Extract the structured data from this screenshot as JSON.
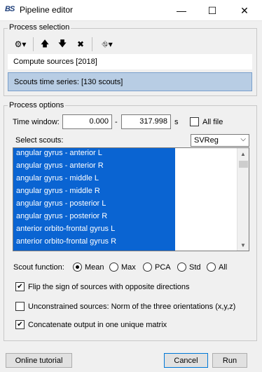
{
  "window": {
    "title": "Pipeline editor",
    "app_icon": "BS",
    "minimize_glyph": "—",
    "maximize_glyph": "☐",
    "close_glyph": "✕"
  },
  "process_selection": {
    "legend": "Process selection",
    "toolbar_glyphs": {
      "settings": "⚙▾",
      "up": "🡅",
      "down": "🡇",
      "delete": "✖",
      "pipeline": "⛗▾"
    },
    "items": [
      "Compute sources [2018]",
      "Scouts time series: [130 scouts]"
    ]
  },
  "process_options": {
    "legend": "Process options",
    "time_window_label": "Time window:",
    "time_start": "0.000",
    "time_sep": "-",
    "time_end": "317.998",
    "time_unit": "s",
    "all_file_label": "All file",
    "select_scouts_label": "Select scouts:",
    "atlas": "SVReg",
    "scouts": [
      "angular gyrus - anterior L",
      "angular gyrus - anterior R",
      "angular gyrus - middle L",
      "angular gyrus - middle R",
      "angular gyrus - posterior L",
      "angular gyrus - posterior R",
      "anterior orbito-frontal gyrus L",
      "anterior orbito-frontal gyrus R"
    ],
    "scout_function_label": "Scout function:",
    "scout_function_options": [
      "Mean",
      "Max",
      "PCA",
      "Std",
      "All"
    ],
    "scout_function_selected": "Mean",
    "flip_label": "Flip the sign of sources with opposite directions",
    "flip_checked": true,
    "unconstrained_label": "Unconstrained sources: Norm of the three orientations (x,y,z)",
    "unconstrained_checked": false,
    "concatenate_label": "Concatenate output in one unique matrix",
    "concatenate_checked": true
  },
  "footer": {
    "tutorial_label": "Online tutorial",
    "cancel_label": "Cancel",
    "run_label": "Run"
  }
}
